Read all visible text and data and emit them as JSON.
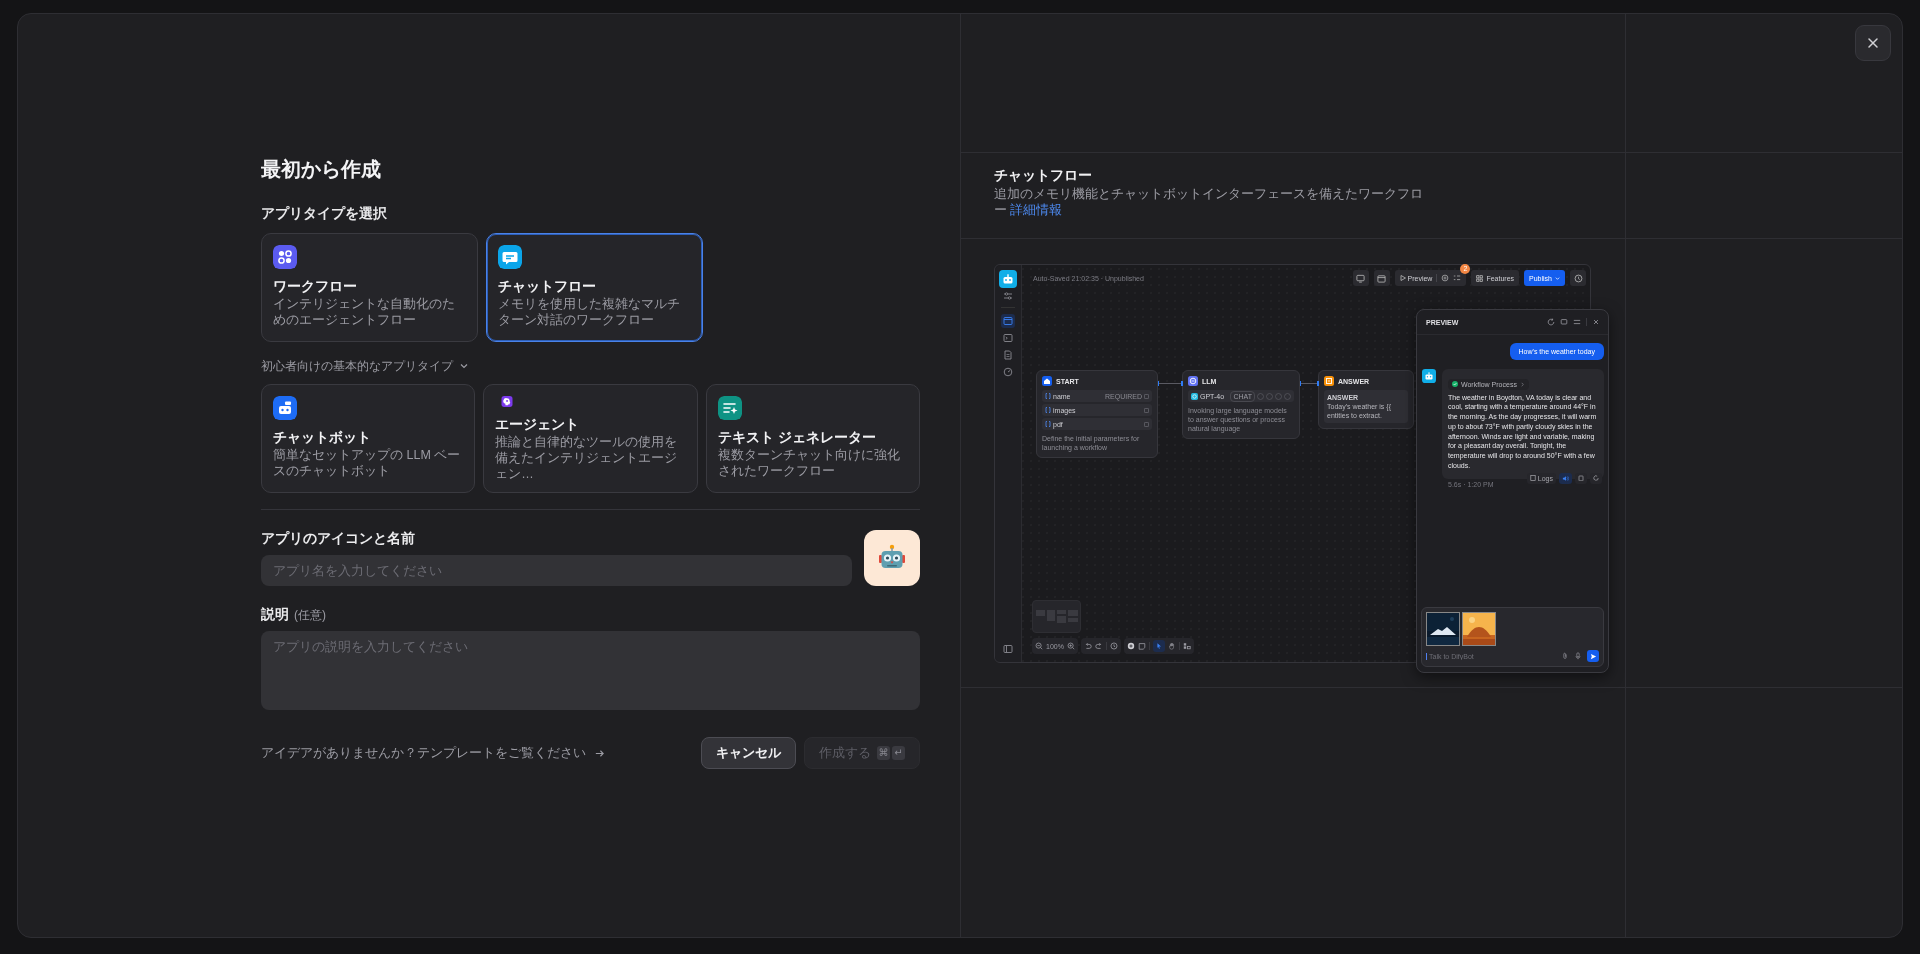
{
  "title": "最初から作成",
  "app_types": {
    "heading": "アプリタイプを選択",
    "items": [
      {
        "kind": "workflow",
        "name": "ワークフロー",
        "description": "インテリジェントな自動化のためのエージェントフロー",
        "selected": false
      },
      {
        "kind": "chatflow",
        "name": "チャットフロー",
        "description": "メモリを使用した複雑なマルチターン対話のワークフロー",
        "selected": true
      }
    ]
  },
  "beginner_types": {
    "heading": "初心者向けの基本的なアプリタイプ",
    "expanded": true,
    "items": [
      {
        "kind": "chatbot",
        "name": "チャットボット",
        "description": "簡単なセットアップの LLM ベースのチャットボット",
        "selected": false
      },
      {
        "kind": "agent",
        "name": "エージェント",
        "description": "推論と自律的なツールの使用を備えたインテリジェントエージェン…",
        "selected": false
      },
      {
        "kind": "text_generator",
        "name": "テキスト ジェネレーター",
        "description": "複数ターンチャット向けに強化されたワークフロー",
        "selected": false
      }
    ]
  },
  "name_field": {
    "label": "アプリのアイコンと名前",
    "placeholder": "アプリ名を入力してください"
  },
  "description_field": {
    "label": "説明",
    "hint": "(任意)",
    "placeholder": "アプリの説明を入力してください"
  },
  "footer": {
    "template_link": "アイデアがありませんか？テンプレートをご覧ください",
    "cancel": "キャンセル",
    "create": {
      "label": "作成する",
      "disabled": true,
      "keys": [
        "⌘",
        "↵"
      ]
    }
  },
  "info": {
    "title": "チャットフロー",
    "description": "追加のメモリ機能とチャットボットインターフェースを備えたワークフロー",
    "link": "詳細情報"
  },
  "preview": {
    "status": "Auto-Saved 21:02:35 · Unpublished",
    "sidebar": [
      {
        "selected": true
      },
      {
        "selected": false
      },
      {
        "selected": false
      },
      {
        "selected": false
      }
    ],
    "toolbar": {
      "preview": "Preview",
      "badge": "2",
      "features": "Features",
      "publish": "Publish"
    },
    "nodes": [
      {
        "kind": "start",
        "title": "START",
        "variables": [
          {
            "name": "name",
            "tag": "REQUIRED"
          },
          {
            "name": "images"
          },
          {
            "name": "pdf"
          }
        ],
        "description": "Define the initial parameters for launching a workflow"
      },
      {
        "kind": "llm",
        "title": "LLM",
        "model": "GPT-4o",
        "mode": "CHAT",
        "description": "Invoking large language models to answer questions or process natural language"
      },
      {
        "kind": "answer",
        "title": "ANSWER",
        "label": "ANSWER",
        "lines": [
          "Today's weather is {{",
          "entities to extract."
        ]
      }
    ],
    "zoom": "100%",
    "chat": {
      "title": "PREVIEW",
      "user_message": "How's the weather today",
      "process": "Workflow Process",
      "process_done": true,
      "answer": "The weather in Boydton, VA today is clear and cool, starting with a temperature around 44°F in the morning. As the day progresses, it will warm up to about 73°F with partly cloudy skies in the afternoon. Winds are light and variable, making for a pleasant day overall. Tonight, the temperature will drop to around 50°F with a few clouds.",
      "logs": "Logs",
      "meta": "5.6s · 1:20 PM",
      "input_placeholder": "Talk to DifyBot"
    }
  }
}
